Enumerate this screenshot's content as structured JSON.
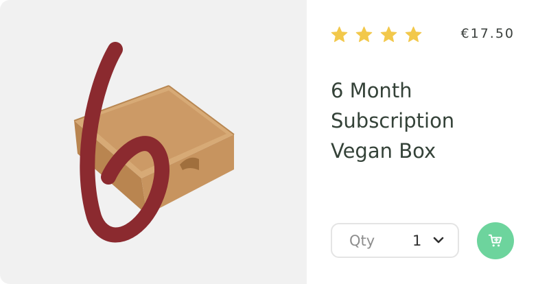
{
  "product": {
    "rating": 4,
    "price": "€17.50",
    "title": "6 Month Subscription Vegan Box",
    "image_alt_letter": "b"
  },
  "quantity": {
    "label": "Qty",
    "value": "1"
  },
  "colors": {
    "star": "#f2c84b",
    "cart_button": "#6dd49d",
    "brand_letter": "#8b2a2f",
    "title_text": "#344238"
  },
  "icons": {
    "rating": "star-icon",
    "quantity_dropdown": "chevron-down-icon",
    "add_to_cart": "add-to-cart-icon"
  }
}
